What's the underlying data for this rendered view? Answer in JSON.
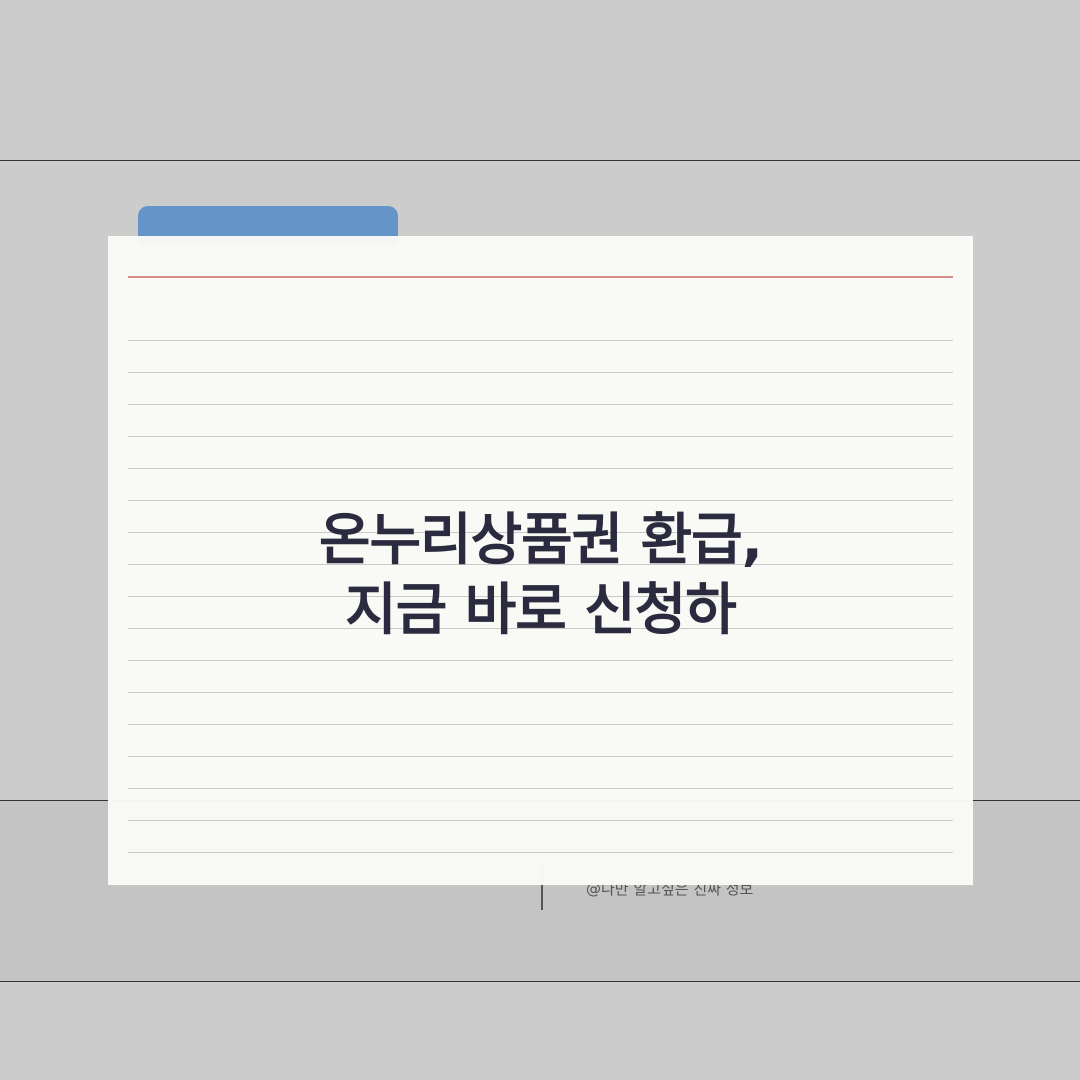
{
  "title": {
    "line1": "온누리상품권 환급,",
    "line2": "지금 바로 신청하"
  },
  "credit": "@나만 알고싶은 진짜 정보",
  "colors": {
    "background": "#cccccc",
    "folder_tab": "#6594c9",
    "card": "#fafaf6",
    "margin_rule": "#d98a8a",
    "title_text": "#2b2b3f"
  }
}
